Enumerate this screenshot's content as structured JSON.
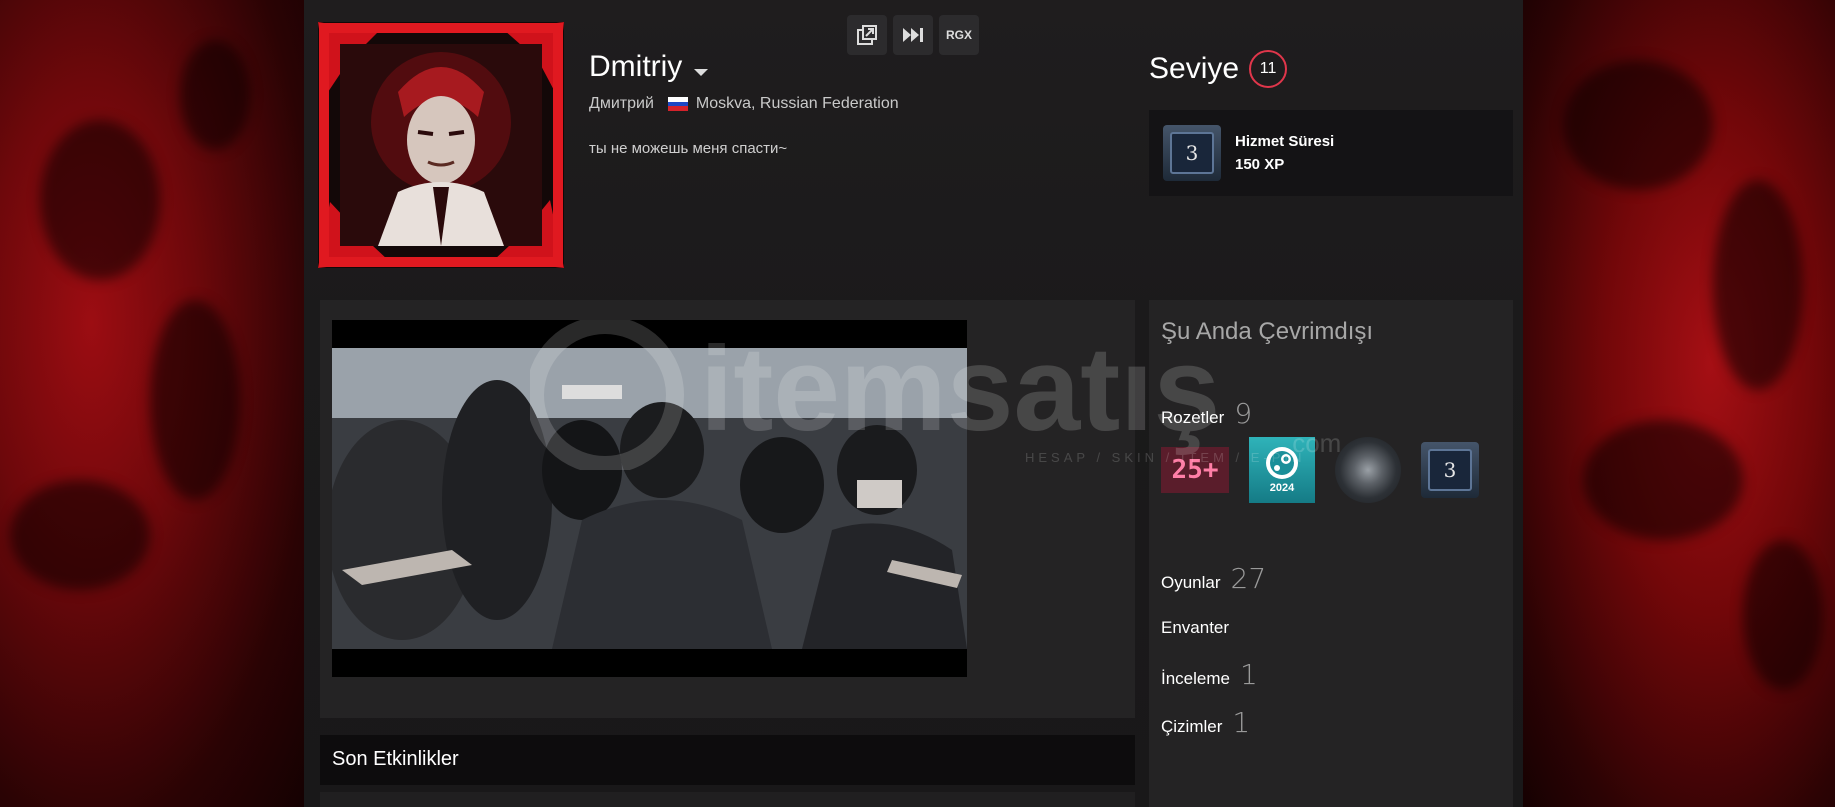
{
  "profile": {
    "persona_name": "Dmitriy",
    "real_name": "Дмитрий",
    "location": "Moskva, Russian Federation",
    "summary": "ты не можешь меня спасти~"
  },
  "top_buttons": [
    {
      "icon": "external-link-icon"
    },
    {
      "icon": "skip-forward-icon"
    },
    {
      "label": "RGX"
    }
  ],
  "level": {
    "label": "Seviye",
    "value": "11"
  },
  "favorite_badge": {
    "icon_text": "3",
    "title": "Hizmet Süresi",
    "xp": "150 XP"
  },
  "right": {
    "status": "Şu Anda Çevrimdışı",
    "badges_label": "Rozetler",
    "badges_count": "9",
    "badge_items": [
      {
        "name": "25+",
        "text": "25+"
      },
      {
        "name": "steam-2024",
        "text": "2024"
      },
      {
        "name": "tire"
      },
      {
        "name": "years-service",
        "text": "3"
      }
    ],
    "games_label": "Oyunlar",
    "games_count": "27",
    "inventory_label": "Envanter",
    "reviews_label": "İnceleme",
    "reviews_count": "1",
    "artwork_label": "Çizimler",
    "artwork_count": "1"
  },
  "recent_activity": {
    "title": "Son Etkinlikler"
  },
  "watermark": {
    "brand": "itemsatış",
    "tagline": "HESAP / SKIN / ITEM / E-PIN",
    "suffix": ".com"
  },
  "colors": {
    "level_ring": "#e0364b",
    "page_bg": "#1b1a1b",
    "panel_bg": "#242324"
  }
}
